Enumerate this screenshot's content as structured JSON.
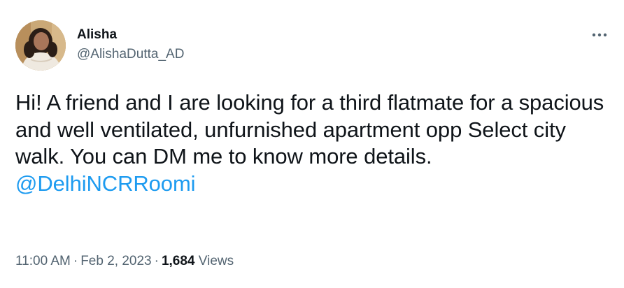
{
  "author": {
    "display_name": "Alisha",
    "handle": "@AlishaDutta_AD"
  },
  "tweet": {
    "text": "Hi! A friend and I are looking for a third flatmate for a spacious and well ventilated, unfurnished apartment opp Select city walk. You can DM me to know more details.",
    "mention": "@DelhiNCRRoomi"
  },
  "meta": {
    "time": "11:00 AM",
    "separator": "·",
    "date": "Feb 2, 2023",
    "views_count": "1,684",
    "views_label": "Views"
  },
  "icons": {
    "more": "more-horizontal-icon"
  },
  "colors": {
    "link": "#1d9bf0",
    "secondary_text": "#536471",
    "primary_text": "#0f1419"
  }
}
